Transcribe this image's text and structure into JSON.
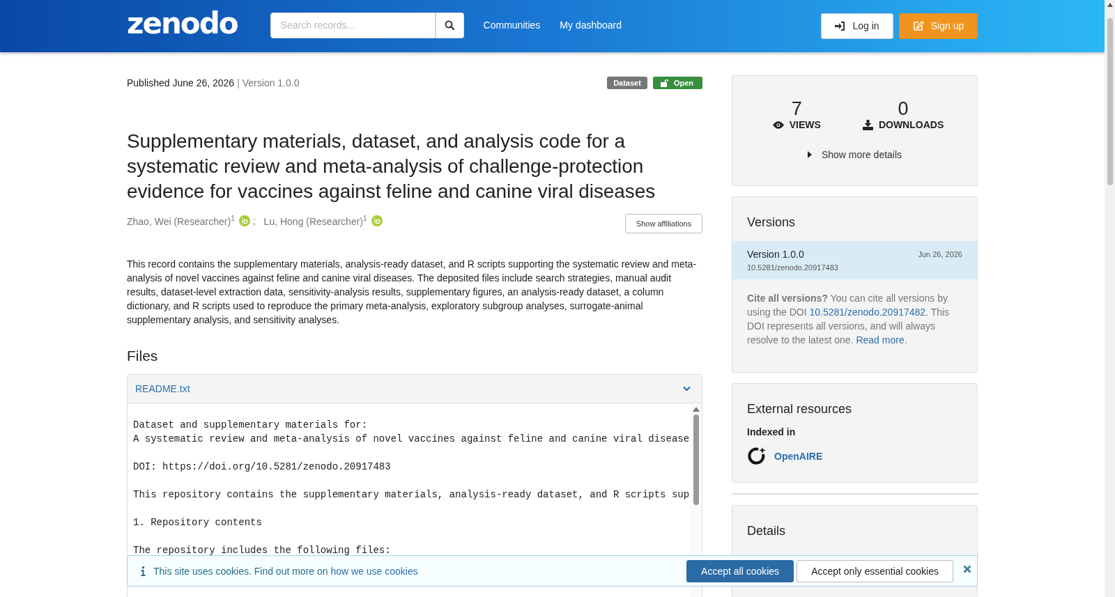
{
  "header": {
    "logo": "zenodo",
    "search": {
      "placeholder": "Search records..."
    },
    "nav": [
      "Communities",
      "My dashboard"
    ],
    "buttons": [
      {
        "label": "Log in",
        "kind": "login"
      },
      {
        "label": "Sign up",
        "kind": "signup"
      }
    ]
  },
  "record": {
    "published": "Published June 26, 2026",
    "separator": "|",
    "version": "Version 1.0.0",
    "badges": [
      {
        "label": "Dataset",
        "kind": "type"
      },
      {
        "label": "Open",
        "kind": "access"
      }
    ],
    "title": "Supplementary materials, dataset, and analysis code for a systematic review and meta-analysis of challenge-protection evidence for vaccines against feline and canine viral diseases",
    "creators": [
      {
        "name": "Zhao, Wei (Researcher)$^{1}$",
        "orcid": true,
        "separator": ";"
      },
      {
        "name": "Lu, Hong (Researcher)$^{1}$",
        "orcid": true
      }
    ],
    "affiliations_button": "Show affiliations",
    "description": "This record contains the supplementary materials, analysis-ready dataset, and R scripts supporting the systematic review and meta-analysis of novel vaccines against feline and canine viral diseases. The deposited files include search strategies, manual audit results, dataset-level extraction data, sensitivity-analysis results, supplementary figures, an analysis-ready dataset, a column dictionary, and R scripts used to reproduce the primary meta-analysis, exploratory subgroup analyses, surrogate-animal supplementary analysis, and sensitivity analyses.",
    "files": {
      "heading": "Files",
      "preview": {
        "filename": "README.txt",
        "expanded": true,
        "blocks": [
          [
            "Dataset and supplementary materials for:",
            "A systematic review and meta-analysis of novel vaccines against feline and canine viral disease"
          ],
          [
            "DOI: https://doi.org/10.5281/zenodo.20917483"
          ],
          [
            "This repository contains the supplementary materials, analysis-ready dataset, and R scripts sup"
          ],
          [
            "1. Repository contents"
          ],
          [
            "The repository includes the following files:"
          ]
        ]
      }
    }
  },
  "sidebar": {
    "stats": [
      {
        "value": "7",
        "label": "VIEWS",
        "kind": "views"
      },
      {
        "value": "0",
        "label": "DOWNLOADS",
        "kind": "downloads"
      }
    ],
    "more_details": {
      "label": "Show more details",
      "expanded": false
    },
    "versions": {
      "heading": "Versions",
      "items": [
        {
          "version": "Version 1.0.0",
          "date": "Jun 26, 2026",
          "doi": "10.5281/zenodo.20917483",
          "selected": true
        }
      ],
      "cite": {
        "lead": "Cite all versions?",
        "text_1": " You can cite all versions by using the DOI ",
        "link_1": "10.5281/zenodo.20917482",
        "text_2": ". This DOI represents all versions, and will always resolve to the latest one. ",
        "link_2": "Read more",
        "text_3": "."
      }
    },
    "external": {
      "heading": "External resources",
      "subheading": "Indexed in",
      "items": [
        {
          "name": "OpenAIRE"
        }
      ]
    },
    "details": {
      "heading": "Details"
    }
  },
  "cookies": {
    "text": "This site uses cookies. Find out more on ",
    "link": "how we use cookies",
    "buttons": [
      {
        "label": "Accept all cookies",
        "kind": "primary"
      },
      {
        "label": "Accept only essential cookies",
        "kind": "secondary"
      }
    ]
  }
}
